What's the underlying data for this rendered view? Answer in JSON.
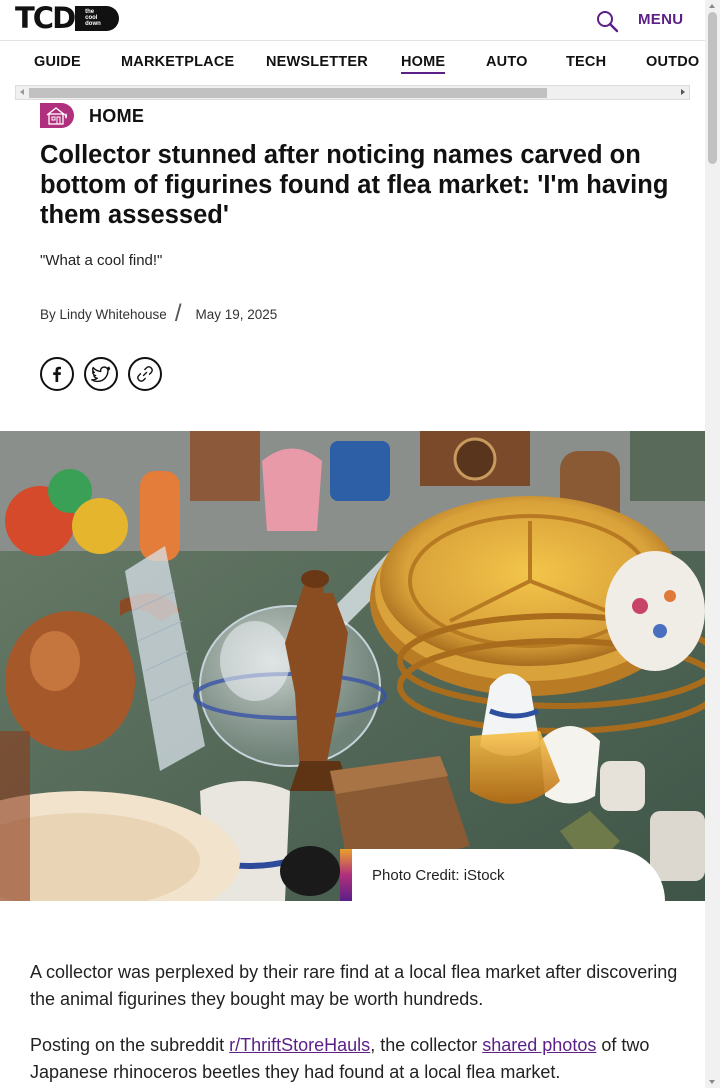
{
  "header": {
    "logo_text": "TCD",
    "logo_sub": "the cool down",
    "menu_label": "MENU"
  },
  "nav": {
    "items": [
      "GUIDE",
      "MARKETPLACE",
      "NEWSLETTER",
      "HOME",
      "AUTO",
      "TECH",
      "OUTDO"
    ],
    "active": "HOME"
  },
  "article": {
    "category": "HOME",
    "headline": "Collector stunned after noticing names carved on bottom of figurines found at flea market: 'I'm having them assessed'",
    "dek": "\"What a cool find!\"",
    "author": "By Lindy Whitehouse",
    "separator": "/",
    "date": "May 19, 2025",
    "share_icons": [
      "facebook-icon",
      "twitter-icon",
      "link-icon"
    ],
    "photo_credit": "Photo Credit: iStock",
    "paragraph1": "A collector was perplexed by their rare find at a local flea market after discovering the animal figurines they bought may be worth hundreds.",
    "paragraph2": {
      "before": "Posting on the subreddit ",
      "link1": "r/ThriftStoreHauls",
      "middle": ", the collector ",
      "link2": "shared photos",
      "after": " of two Japanese rhinoceros beetles they had found at a local flea market."
    }
  },
  "colors": {
    "brand_purple": "#5b1f87",
    "category_magenta": "#b0307d"
  }
}
